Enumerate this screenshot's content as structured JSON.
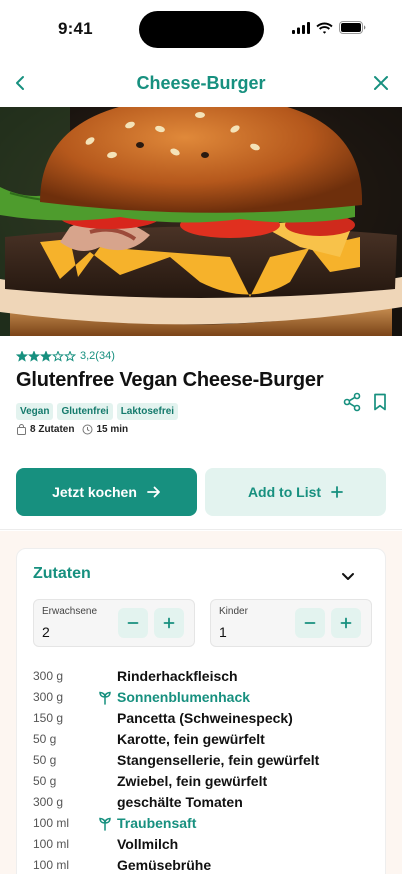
{
  "status": {
    "time": "9:41"
  },
  "nav": {
    "title": "Cheese-Burger"
  },
  "recipe": {
    "rating_text": "3,2(34)",
    "stars": 3,
    "stars_max": 5,
    "title": "Glutenfree Vegan Cheese-Burger",
    "tags": [
      "Vegan",
      "Glutenfrei",
      "Laktosefrei"
    ],
    "ingredients_count": "8 Zutaten",
    "duration": "15 min"
  },
  "actions": {
    "cook_label": "Jetzt kochen",
    "list_label": "Add to List"
  },
  "ingredients_card": {
    "title": "Zutaten",
    "adults": {
      "label": "Erwachsene",
      "value": "2"
    },
    "kids": {
      "label": "Kinder",
      "value": "1"
    },
    "items": [
      {
        "qty": "300 g",
        "name": "Rinderhackfleisch",
        "vegan_swap": false
      },
      {
        "qty": "300 g",
        "name": "Sonnenblumenhack",
        "vegan_swap": true
      },
      {
        "qty": "150 g",
        "name": "Pancetta (Schweinespeck)",
        "vegan_swap": false
      },
      {
        "qty": "50 g",
        "name": "Karotte, fein gewürfelt",
        "vegan_swap": false
      },
      {
        "qty": "50 g",
        "name": "Stangensellerie, fein gewürfelt",
        "vegan_swap": false
      },
      {
        "qty": "50 g",
        "name": "Zwiebel, fein gewürfelt",
        "vegan_swap": false
      },
      {
        "qty": "300 g",
        "name": "geschälte Tomaten",
        "vegan_swap": false
      },
      {
        "qty": "100 ml",
        "name": "Traubensaft",
        "vegan_swap": true
      },
      {
        "qty": "100 ml",
        "name": "Vollmilch",
        "vegan_swap": false
      },
      {
        "qty": "100 ml",
        "name": "Gemüsebrühe",
        "vegan_swap": false
      }
    ]
  },
  "colors": {
    "accent": "#17907f",
    "accent_light": "#e3f3ef",
    "section_bg": "#fdf6f1"
  },
  "icons": [
    "back-icon",
    "close-icon",
    "star-icon",
    "share-icon",
    "bookmark-icon",
    "bag-icon",
    "clock-icon",
    "arrow-right-icon",
    "plus-icon",
    "minus-icon",
    "chevron-down-icon",
    "leaf-icon"
  ]
}
